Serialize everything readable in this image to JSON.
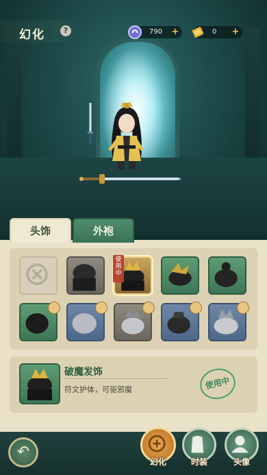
{
  "header": {
    "title": "幻化",
    "help_label": "?"
  },
  "currencies": [
    {
      "icon": "spirit-orb-icon",
      "value": "790",
      "plus": "+"
    },
    {
      "icon": "gold-ticket-icon",
      "value": "0",
      "plus": "+"
    }
  ],
  "tabs": [
    {
      "label": "头饰",
      "active": true
    },
    {
      "label": "外袍",
      "active": false
    }
  ],
  "grid": {
    "using_tag": "使用中",
    "slots": [
      {
        "type": "empty"
      },
      {
        "type": "gray"
      },
      {
        "type": "gold-selected"
      },
      {
        "type": "green"
      },
      {
        "type": "green"
      },
      {
        "type": "green",
        "locked": true
      },
      {
        "type": "blue",
        "locked": true
      },
      {
        "type": "gray",
        "locked": true
      },
      {
        "type": "blue",
        "locked": true
      },
      {
        "type": "blue",
        "locked": true
      }
    ]
  },
  "detail": {
    "name": "破魔发饰",
    "description": "符文护体，可驱邪魔",
    "status_stamp": "使用中"
  },
  "bottom_nav": [
    {
      "label": "幻化",
      "active": true
    },
    {
      "label": "时装",
      "active": false
    },
    {
      "label": "头像",
      "active": false
    }
  ],
  "colors": {
    "panel": "#e9e1c8",
    "accent_green": "#3f8a59",
    "accent_gold": "#e7a64c",
    "tag_red": "#b8442f"
  }
}
